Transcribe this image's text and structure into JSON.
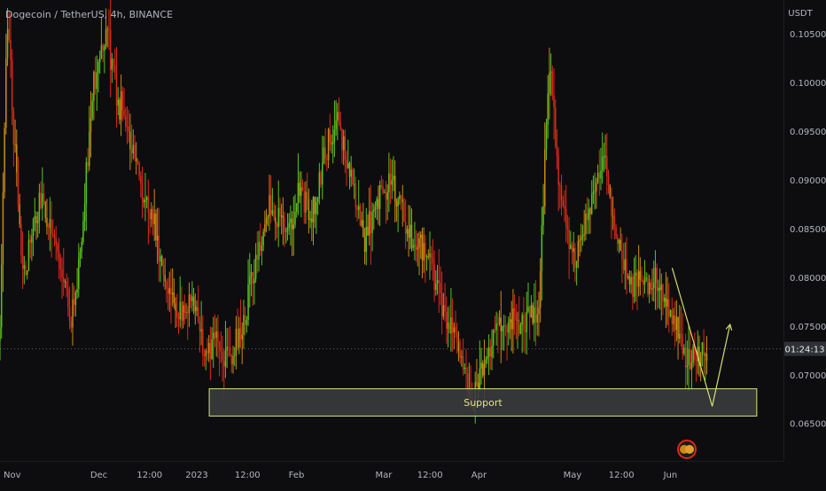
{
  "chart_data": {
    "type": "candlestick",
    "title": "Dogecoin / TetherUS, 4h, BINANCE",
    "y_unit": "USDT",
    "ylim": [
      0.0612,
      0.1085
    ],
    "y_ticks": [
      "0.10500",
      "0.10000",
      "0.09500",
      "0.09000",
      "0.08500",
      "0.08000",
      "0.07500",
      "0.07000",
      "0.06500"
    ],
    "x_ticks": [
      "Nov",
      "Dec",
      "12:00",
      "2023",
      "12:00",
      "Feb",
      "Mar",
      "12:00",
      "Apr",
      "May",
      "12:00",
      "Jun"
    ],
    "price_path": [
      [
        0.0,
        0.0735
      ],
      [
        0.8,
        0.107
      ],
      [
        2.5,
        0.08
      ],
      [
        4.5,
        0.088
      ],
      [
        6.5,
        0.083
      ],
      [
        8.0,
        0.076
      ],
      [
        9.0,
        0.082
      ],
      [
        10.5,
        0.1
      ],
      [
        12.0,
        0.106
      ],
      [
        13.0,
        0.099
      ],
      [
        14.5,
        0.095
      ],
      [
        15.5,
        0.091
      ],
      [
        17.0,
        0.087
      ],
      [
        18.5,
        0.08
      ],
      [
        20.0,
        0.076
      ],
      [
        21.5,
        0.078
      ],
      [
        23.0,
        0.072
      ],
      [
        24.5,
        0.073
      ],
      [
        26.0,
        0.072
      ],
      [
        27.5,
        0.076
      ],
      [
        29.0,
        0.083
      ],
      [
        30.5,
        0.088
      ],
      [
        32.0,
        0.084
      ],
      [
        33.5,
        0.089
      ],
      [
        35.0,
        0.086
      ],
      [
        36.5,
        0.093
      ],
      [
        38.0,
        0.096
      ],
      [
        39.5,
        0.09
      ],
      [
        41.0,
        0.084
      ],
      [
        42.5,
        0.088
      ],
      [
        44.0,
        0.09
      ],
      [
        45.5,
        0.086
      ],
      [
        47.0,
        0.083
      ],
      [
        48.5,
        0.081
      ],
      [
        50.0,
        0.076
      ],
      [
        52.0,
        0.072
      ],
      [
        53.0,
        0.067
      ],
      [
        54.5,
        0.071
      ],
      [
        56.5,
        0.076
      ],
      [
        58.5,
        0.075
      ],
      [
        60.5,
        0.077
      ],
      [
        61.7,
        0.102
      ],
      [
        63.0,
        0.088
      ],
      [
        64.5,
        0.082
      ],
      [
        66.5,
        0.088
      ],
      [
        68.0,
        0.093
      ],
      [
        69.0,
        0.085
      ],
      [
        70.5,
        0.08
      ],
      [
        72.5,
        0.079
      ],
      [
        74.0,
        0.08
      ],
      [
        75.5,
        0.076
      ],
      [
        77.0,
        0.072
      ],
      [
        78.5,
        0.072
      ],
      [
        79.5,
        0.0727
      ]
    ],
    "current_price": 0.0727,
    "countdown": "01:24:13",
    "support_zone": {
      "label": "Support",
      "from": 0.0658,
      "to": 0.0686,
      "x_start": 23.5,
      "x_end": 85.0
    },
    "projection": [
      [
        75.5,
        0.081
      ],
      [
        80.0,
        0.0668
      ],
      [
        82.0,
        0.0752
      ]
    ],
    "colors": {
      "up": "#5bc01f",
      "down": "#d9281b",
      "mixed": "#c88a16",
      "zone_border": "#d7e284",
      "zone_fill": "#3a3b3d",
      "zone_text": "#e0e388",
      "projection": "#d3dd6f",
      "price_label_bg": "#2f3136",
      "axis_text": "#b2b5be"
    }
  }
}
